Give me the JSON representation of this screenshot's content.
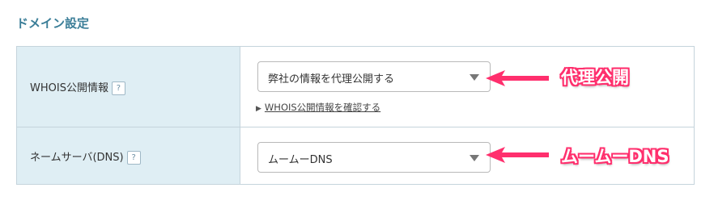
{
  "section": {
    "title": "ドメイン設定"
  },
  "rows": [
    {
      "label": "WHOIS公開情報",
      "help_icon": "?",
      "select_value": "弊社の情報を代理公開する",
      "link_text": "WHOIS公開情報を確認する",
      "link_marker": "▶"
    },
    {
      "label": "ネームサーバ(DNS)",
      "help_icon": "?",
      "select_value": "ムームーDNS"
    }
  ],
  "annotations": [
    {
      "text": "代理公開"
    },
    {
      "text": "ムームーDNS"
    }
  ],
  "colors": {
    "section_title": "#3b7e98",
    "label_background": "#dfeef4",
    "border": "#c5d4dc",
    "annotation_accent": "#ff2f6d"
  },
  "icons": {
    "help": "question-mark-icon",
    "select_caret": "triangle-down-icon",
    "annotation_arrow": "arrow-left-icon"
  }
}
